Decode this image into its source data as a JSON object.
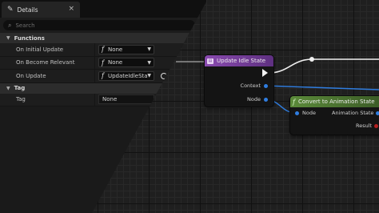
{
  "details_tab": {
    "title": "Details",
    "close_symbol": "×"
  },
  "search": {
    "placeholder": "Search"
  },
  "sections": {
    "functions": {
      "label": "Functions"
    },
    "tag": {
      "label": "Tag"
    }
  },
  "properties": {
    "on_initial_update": {
      "label": "On Initial Update",
      "value": "None"
    },
    "on_become_relevant": {
      "label": "On Become Relevant",
      "value": "None"
    },
    "on_update": {
      "label": "On Update",
      "value": "UpdateIdleState"
    },
    "tag": {
      "label": "Tag",
      "value": "None"
    }
  },
  "nodes": {
    "update_idle_state": {
      "title": "Update Idle State",
      "header_color": "#8a4bb0",
      "pins": {
        "context": "Context",
        "node": "Node"
      }
    },
    "convert_to_animation_state": {
      "title": "Convert to Animation State",
      "header_color": "#5b8a3a",
      "pins": {
        "node": "Node",
        "animation_state": "Animation State",
        "result": "Result"
      }
    }
  },
  "colors": {
    "exec_wire": "#f0f0f0",
    "data_wire": "#2f7de0",
    "result_pin": "#b42020"
  }
}
